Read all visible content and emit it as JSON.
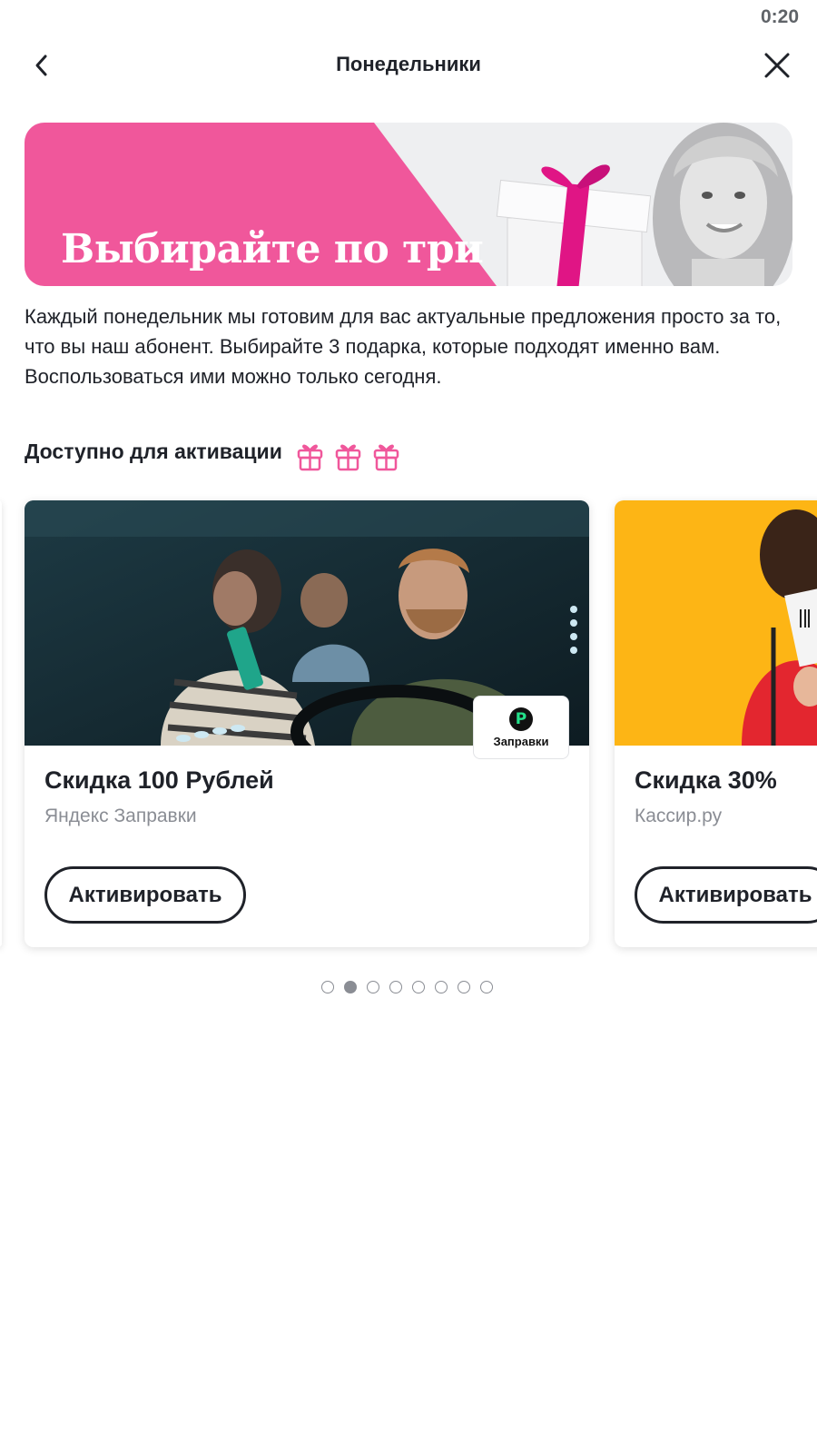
{
  "status_bar": {
    "time": "0:20"
  },
  "header": {
    "title": "Понедельники"
  },
  "banner": {
    "text": "Выбирайте по три подарка каждый",
    "accent_color": "#f0579b"
  },
  "description": "Каждый понедельник мы готовим для вас актуальные предложения просто за то, что вы наш абонент. Выбирайте 3 подарка, которые подходят именно вам. Воспользоваться ими можно только сегодня.",
  "section": {
    "title": "Доступно для активации",
    "gift_icon": "gift-icon",
    "gift_count": 3,
    "gift_color": "#f0579b"
  },
  "cards": [
    {
      "title": "Скидка 100 Рублей",
      "partner": "Яндекс Заправки",
      "button": "Активировать",
      "badge_label": "Заправки",
      "badge_logo": "P"
    },
    {
      "title": "Скидка 30%",
      "partner": "Кассир.ру",
      "button": "Активировать"
    }
  ],
  "pagination": {
    "total": 8,
    "active_index": 1
  }
}
